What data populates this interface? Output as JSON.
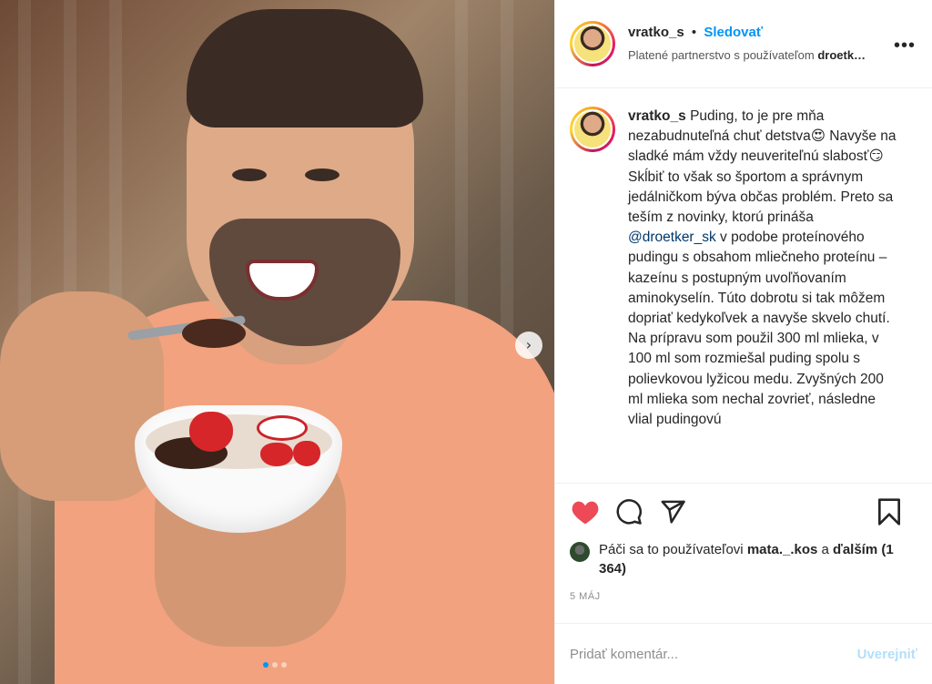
{
  "header": {
    "username": "vratko_s",
    "separator": "•",
    "follow_label": "Sledovať",
    "partnership_prefix": "Platené partnerstvo s používateľom",
    "partnership_user": "droetk…",
    "more_icon": "more-horizontal-icon"
  },
  "caption": {
    "username": "vratko_s",
    "text_part1": "Puding, to je pre mňa nezabudnuteľná chuť detstva😍 Navyše na sladké mám vždy neuveriteľnú slabosť😏Skĺbiť to však so športom a správnym jedálničkom býva občas problém. Preto sa teším z novinky, ktorú prináša",
    "mention": "@droetker_sk",
    "text_part2": "v podobe proteínového pudingu s obsahom mliečneho proteínu – kazeínu s postupným uvoľňovaním aminokyselín. Túto dobrotu si tak môžem dopriať kedykoľvek a navyše skvelo chutí. Na prípravu som použil 300 ml mlieka, v 100 ml som rozmiešal puding spolu s polievkovou lyžicou medu. Zvyšných 200 ml mlieka som nechal zovrieť, následne vlial pudingovú"
  },
  "actions": {
    "like_icon": "heart-filled-icon",
    "comment_icon": "comment-icon",
    "share_icon": "send-icon",
    "save_icon": "bookmark-icon",
    "like_color": "#ed4956"
  },
  "likes": {
    "prefix": "Páči sa to používateľovi",
    "user": "mata._.kos",
    "middle": "a",
    "others": "ďalším (1 364)"
  },
  "date": "5 MÁJ",
  "comment": {
    "placeholder": "Pridať komentár...",
    "post_label": "Uverejniť"
  },
  "media": {
    "next_icon": "chevron-right-icon",
    "carousel_count": 3,
    "carousel_active": 1,
    "accent": "#0095f6"
  }
}
